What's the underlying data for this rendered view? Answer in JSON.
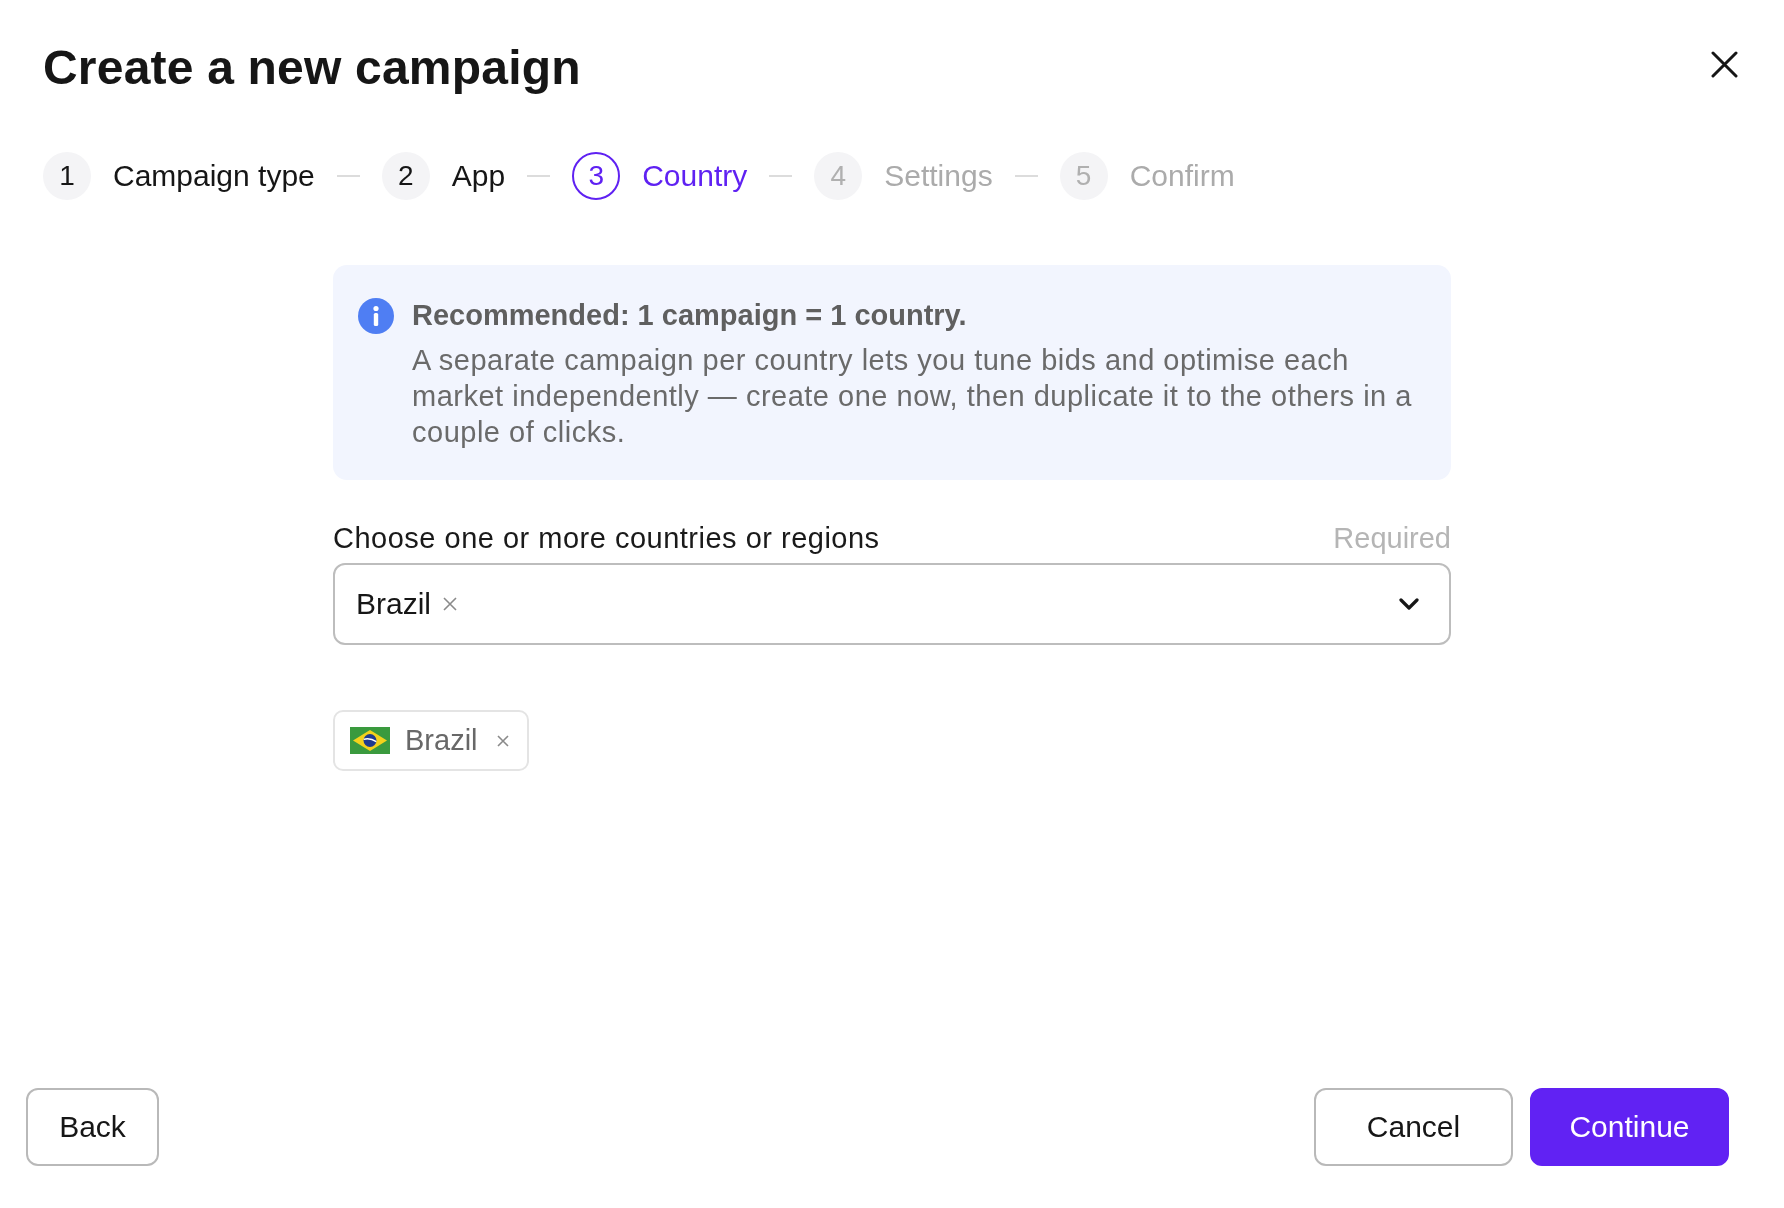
{
  "dialog": {
    "title": "Create a new campaign"
  },
  "steps": [
    {
      "number": "1",
      "label": "Campaign type",
      "selected": false,
      "completed": true
    },
    {
      "number": "2",
      "label": "App",
      "selected": false,
      "completed": true
    },
    {
      "number": "3",
      "label": "Country",
      "selected": true,
      "completed": false
    },
    {
      "number": "4",
      "label": "Settings",
      "selected": false,
      "completed": false
    },
    {
      "number": "5",
      "label": "Confirm",
      "selected": false,
      "completed": false
    }
  ],
  "info_banner": {
    "title": "Recommended: 1 campaign = 1 country.",
    "body": "A separate campaign per country lets you tune bids and optimise each market independently — create one now, then duplicate it to the others in a couple of clicks."
  },
  "country_field": {
    "label": "Choose one or more countries or regions",
    "hint": "Required",
    "values": [
      "Brazil"
    ]
  },
  "selected_countries": [
    {
      "name": "Brazil"
    }
  ],
  "footer": {
    "left_buttons": [
      {
        "label": "Back",
        "kind": "secondary"
      }
    ],
    "right_buttons": [
      {
        "label": "Cancel",
        "kind": "secondary"
      },
      {
        "label": "Continue",
        "kind": "primary"
      }
    ]
  }
}
